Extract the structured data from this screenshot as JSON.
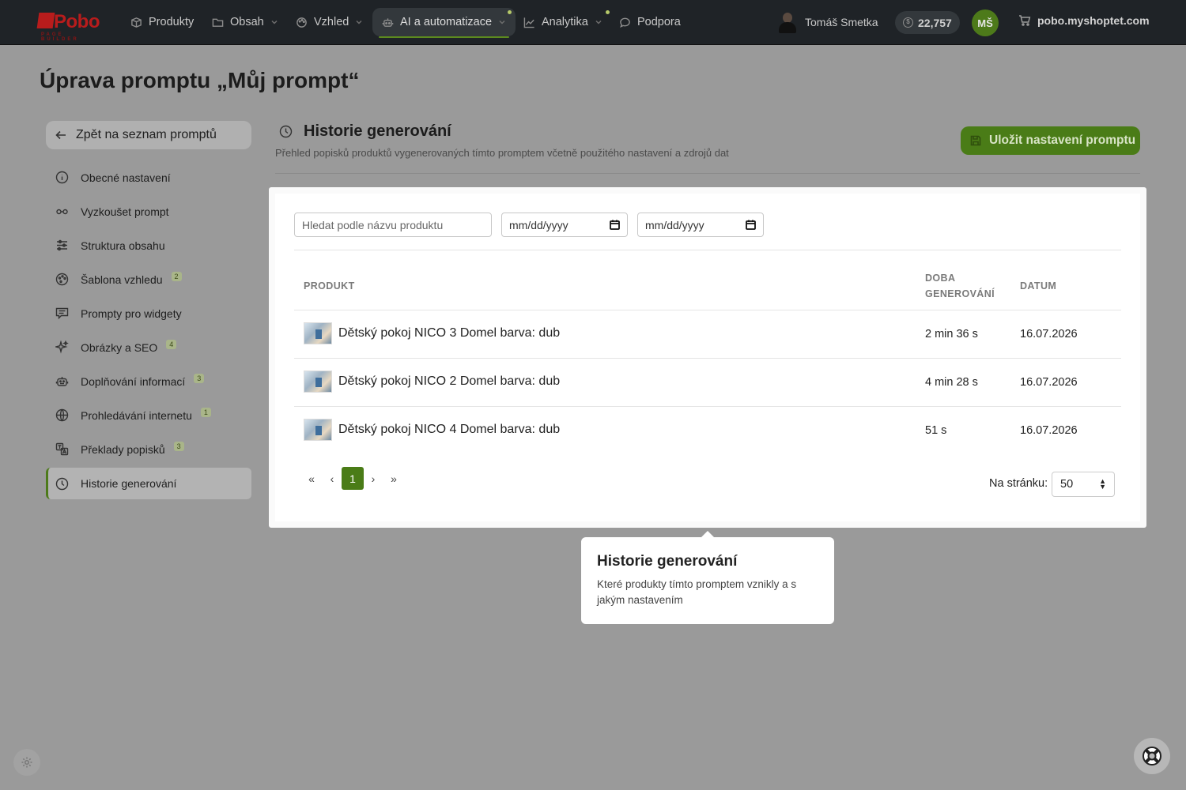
{
  "nav": {
    "logo_text": "Pobo",
    "logo_sub": "PAGE BUILDER",
    "items": [
      {
        "label": "Produkty",
        "icon": "box-icon"
      },
      {
        "label": "Obsah",
        "icon": "folder-icon"
      },
      {
        "label": "Vzhled",
        "icon": "palette-icon"
      },
      {
        "label": "AI a automatizace",
        "icon": "robot-icon",
        "active": true
      },
      {
        "label": "Analytika",
        "icon": "chart-icon"
      },
      {
        "label": "Podpora",
        "icon": "chat-icon"
      }
    ],
    "user_name": "Tomáš Smetka",
    "credits": "22,757",
    "initials": "MŠ",
    "shop": "pobo.myshoptet.com"
  },
  "page_title": "Úprava promptu „Můj prompt“",
  "sidebar": {
    "back_label": "Zpět na seznam promptů",
    "items": [
      {
        "label": "Obecné nastavení",
        "badge": ""
      },
      {
        "label": "Vyzkoušet prompt",
        "badge": ""
      },
      {
        "label": "Struktura obsahu",
        "badge": ""
      },
      {
        "label": "Šablona vzhledu",
        "badge": "2"
      },
      {
        "label": "Prompty pro widgety",
        "badge": ""
      },
      {
        "label": "Obrázky a SEO",
        "badge": "4"
      },
      {
        "label": "Doplňování informací",
        "badge": "3"
      },
      {
        "label": "Prohledávání internetu",
        "badge": "1"
      },
      {
        "label": "Překlady popisků",
        "badge": "3"
      },
      {
        "label": "Historie generování",
        "badge": "",
        "active": true
      }
    ]
  },
  "section": {
    "title": "Historie generování",
    "subtitle": "Přehled popisků produktů vygenerovaných tímto promptem včetně použitého nastavení a zdrojů dat",
    "save_label": "Uložit nastavení promptu"
  },
  "filters": {
    "search_placeholder": "Hledat podle názvu produktu",
    "date_from": "mm/dd/yyyy",
    "date_to": "mm/dd/yyyy"
  },
  "table": {
    "headers": {
      "product": "PRODUKT",
      "duration_1": "DOBA",
      "duration_2": "GENEROVÁNÍ",
      "date": "DATUM"
    },
    "rows": [
      {
        "name": "Dětský pokoj NICO 3 Domel barva: dub",
        "duration": "2 min 36 s",
        "date": "16.07.2026"
      },
      {
        "name": "Dětský pokoj NICO 2 Domel barva: dub",
        "duration": "4 min 28 s",
        "date": "16.07.2026"
      },
      {
        "name": "Dětský pokoj NICO 4 Domel barva: dub",
        "duration": "51 s",
        "date": "16.07.2026"
      }
    ]
  },
  "pagination": {
    "first": "«",
    "prev": "‹",
    "current": "1",
    "next": "›",
    "last": "»",
    "per_page_label": "Na stránku:",
    "per_page_value": "50"
  },
  "tooltip": {
    "title": "Historie generování",
    "text": "Které produkty tímto promptem vznikly a s jakým nastavením"
  },
  "colors": {
    "accent": "#4a7c17",
    "logo": "#b81c1c",
    "topbar": "#1f2327"
  }
}
